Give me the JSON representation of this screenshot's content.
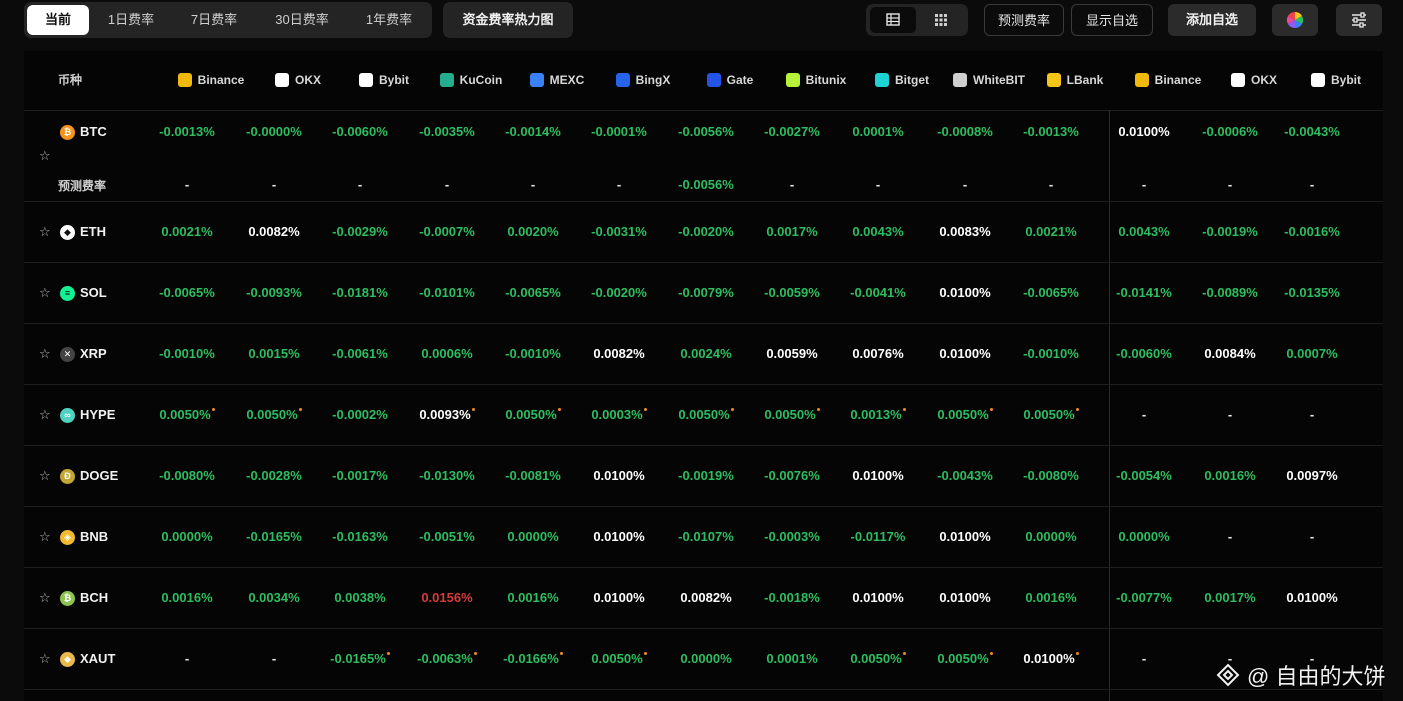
{
  "tabs": [
    "当前",
    "1日费率",
    "7日费率",
    "30日费率",
    "1年费率"
  ],
  "heatmap_label": "资金费率热力图",
  "actions": {
    "predict": "预测费率",
    "show_fav": "显示自选",
    "add_fav": "添加自选"
  },
  "coin_header": "币种",
  "predicted_label": "预测费率",
  "exchanges": [
    {
      "name": "Binance",
      "color": "#f0b90b"
    },
    {
      "name": "OKX",
      "color": "#ffffff"
    },
    {
      "name": "Bybit",
      "color": "#ffffff"
    },
    {
      "name": "KuCoin",
      "color": "#24ae8f"
    },
    {
      "name": "MEXC",
      "color": "#3b82f6"
    },
    {
      "name": "BingX",
      "color": "#2563eb"
    },
    {
      "name": "Gate",
      "color": "#2354e6"
    },
    {
      "name": "Bitunix",
      "color": "#b6f23a"
    },
    {
      "name": "Bitget",
      "color": "#1ed3d3"
    },
    {
      "name": "WhiteBIT",
      "color": "#cfcfcf"
    },
    {
      "name": "LBank",
      "color": "#f5c518"
    },
    {
      "name": "Binance",
      "color": "#f0b90b"
    },
    {
      "name": "OKX",
      "color": "#ffffff"
    },
    {
      "name": "Bybit",
      "color": "#ffffff"
    }
  ],
  "rows": [
    {
      "coin": "BTC",
      "icon": "bitcoin-icon",
      "icon_color": "#f7931a",
      "glyph": "₿",
      "values": [
        "-0.0013%",
        "-0.0000%",
        "-0.0060%",
        "-0.0035%",
        "-0.0014%",
        "-0.0001%",
        "-0.0056%",
        "-0.0027%",
        "0.0001%",
        "-0.0008%",
        "-0.0013%",
        "0.0100%",
        "-0.0006%",
        "-0.0043%"
      ],
      "kinds": [
        "g",
        "g",
        "g",
        "g",
        "g",
        "g",
        "g",
        "g",
        "g",
        "g",
        "g",
        "w",
        "g",
        "g"
      ],
      "predicted": [
        "-",
        "-",
        "-",
        "-",
        "-",
        "-",
        "-0.0056%",
        "-",
        "-",
        "-",
        "-",
        "-",
        "-",
        "-"
      ],
      "pred_kinds": [
        "dash",
        "dash",
        "dash",
        "dash",
        "dash",
        "dash",
        "g",
        "dash",
        "dash",
        "dash",
        "dash",
        "dash",
        "dash",
        "dash"
      ]
    },
    {
      "coin": "ETH",
      "icon": "ethereum-icon",
      "icon_color": "#ffffff",
      "glyph": "◆",
      "values": [
        "0.0021%",
        "0.0082%",
        "-0.0029%",
        "-0.0007%",
        "0.0020%",
        "-0.0031%",
        "-0.0020%",
        "0.0017%",
        "0.0043%",
        "0.0083%",
        "0.0021%",
        "0.0043%",
        "-0.0019%",
        "-0.0016%"
      ],
      "kinds": [
        "g",
        "w",
        "g",
        "g",
        "g",
        "g",
        "g",
        "g",
        "g",
        "w",
        "g",
        "g",
        "g",
        "g"
      ]
    },
    {
      "coin": "SOL",
      "icon": "solana-icon",
      "icon_color": "#14f195",
      "glyph": "≡",
      "values": [
        "-0.0065%",
        "-0.0093%",
        "-0.0181%",
        "-0.0101%",
        "-0.0065%",
        "-0.0020%",
        "-0.0079%",
        "-0.0059%",
        "-0.0041%",
        "0.0100%",
        "-0.0065%",
        "-0.0141%",
        "-0.0089%",
        "-0.0135%"
      ],
      "kinds": [
        "g",
        "g",
        "g",
        "g",
        "g",
        "g",
        "g",
        "g",
        "g",
        "w",
        "g",
        "g",
        "g",
        "g"
      ]
    },
    {
      "coin": "XRP",
      "icon": "xrp-icon",
      "icon_color": "#444444",
      "glyph": "✕",
      "values": [
        "-0.0010%",
        "0.0015%",
        "-0.0061%",
        "0.0006%",
        "-0.0010%",
        "0.0082%",
        "0.0024%",
        "0.0059%",
        "0.0076%",
        "0.0100%",
        "-0.0010%",
        "-0.0060%",
        "0.0084%",
        "0.0007%"
      ],
      "kinds": [
        "g",
        "g",
        "g",
        "g",
        "g",
        "w",
        "g",
        "w",
        "w",
        "w",
        "g",
        "g",
        "w",
        "g"
      ]
    },
    {
      "coin": "HYPE",
      "icon": "hyperliquid-icon",
      "icon_color": "#50d2c1",
      "glyph": "∞",
      "values": [
        "0.0050%",
        "0.0050%",
        "-0.0002%",
        "0.0093%",
        "0.0050%",
        "0.0003%",
        "0.0050%",
        "0.0050%",
        "0.0013%",
        "0.0050%",
        "0.0050%",
        "-",
        "-",
        "-"
      ],
      "kinds": [
        "g",
        "g",
        "g",
        "w",
        "g",
        "g",
        "g",
        "g",
        "g",
        "g",
        "g",
        "dash",
        "dash",
        "dash"
      ],
      "dots": [
        true,
        true,
        false,
        true,
        true,
        true,
        true,
        true,
        true,
        true,
        true,
        false,
        false,
        false
      ]
    },
    {
      "coin": "DOGE",
      "icon": "dogecoin-icon",
      "icon_color": "#c2a633",
      "glyph": "Ð",
      "values": [
        "-0.0080%",
        "-0.0028%",
        "-0.0017%",
        "-0.0130%",
        "-0.0081%",
        "0.0100%",
        "-0.0019%",
        "-0.0076%",
        "0.0100%",
        "-0.0043%",
        "-0.0080%",
        "-0.0054%",
        "0.0016%",
        "0.0097%"
      ],
      "kinds": [
        "g",
        "g",
        "g",
        "g",
        "g",
        "w",
        "g",
        "g",
        "w",
        "g",
        "g",
        "g",
        "g",
        "w"
      ]
    },
    {
      "coin": "BNB",
      "icon": "bnb-icon",
      "icon_color": "#f3ba2f",
      "glyph": "◈",
      "values": [
        "0.0000%",
        "-0.0165%",
        "-0.0163%",
        "-0.0051%",
        "0.0000%",
        "0.0100%",
        "-0.0107%",
        "-0.0003%",
        "-0.0117%",
        "0.0100%",
        "0.0000%",
        "0.0000%",
        "-",
        "-"
      ],
      "kinds": [
        "g",
        "g",
        "g",
        "g",
        "g",
        "w",
        "g",
        "g",
        "g",
        "w",
        "g",
        "g",
        "dash",
        "dash"
      ]
    },
    {
      "coin": "BCH",
      "icon": "bitcoin-cash-icon",
      "icon_color": "#8dc351",
      "glyph": "₿",
      "values": [
        "0.0016%",
        "0.0034%",
        "0.0038%",
        "0.0156%",
        "0.0016%",
        "0.0100%",
        "0.0082%",
        "-0.0018%",
        "0.0100%",
        "0.0100%",
        "0.0016%",
        "-0.0077%",
        "0.0017%",
        "0.0100%"
      ],
      "kinds": [
        "g",
        "g",
        "g",
        "r",
        "g",
        "w",
        "w",
        "g",
        "w",
        "w",
        "g",
        "g",
        "g",
        "w"
      ]
    },
    {
      "coin": "XAUT",
      "icon": "gold-icon",
      "icon_color": "#e9b949",
      "glyph": "◆",
      "values": [
        "-",
        "-",
        "-0.0165%",
        "-0.0063%",
        "-0.0166%",
        "0.0050%",
        "0.0000%",
        "0.0001%",
        "0.0050%",
        "0.0050%",
        "0.0100%",
        "-",
        "-",
        "-"
      ],
      "kinds": [
        "dash",
        "dash",
        "g",
        "g",
        "g",
        "g",
        "g",
        "g",
        "g",
        "g",
        "w",
        "dash",
        "dash",
        "dash"
      ],
      "dots": [
        false,
        false,
        true,
        true,
        true,
        true,
        false,
        false,
        true,
        true,
        true,
        false,
        false,
        false
      ]
    }
  ],
  "watermark": "@ 自由的大饼"
}
